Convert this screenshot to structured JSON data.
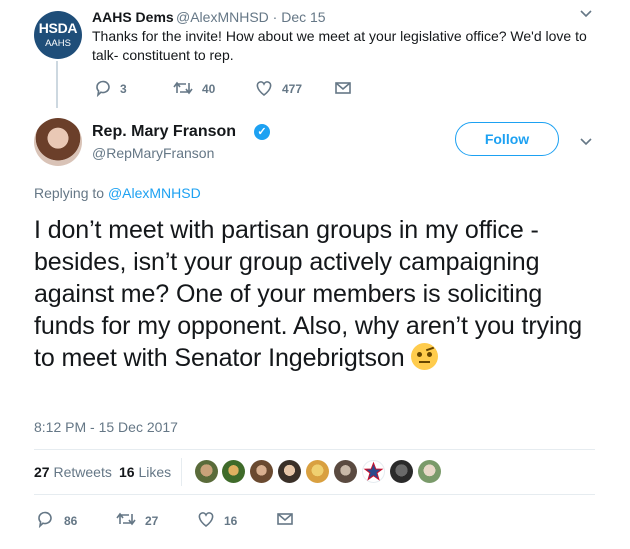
{
  "reply_tweet": {
    "avatar_text": "HSDA",
    "avatar_subtext": "AAHS",
    "display_name": "AAHS Dems",
    "handle_date": "@AlexMNHSD · Dec 15",
    "text": "Thanks for the invite! How about we meet at your legislative office? We'd love to talk- constituent to rep.",
    "reply_count": "3",
    "retweet_count": "40",
    "like_count": "477"
  },
  "main_tweet": {
    "display_name": "Rep. Mary Franson",
    "verified_glyph": "✓",
    "handle": "@RepMaryFranson",
    "follow_label": "Follow",
    "replying_prefix": "Replying to ",
    "replying_to": "@AlexMNHSD",
    "text": "I don’t meet with partisan groups in my office - besides, isn’t your group actively campaigning against me? One of your members is soliciting funds for my opponent. Also, why aren’t you trying to meet with Senator Ingebrigtson",
    "timestamp": "8:12 PM - 15 Dec 2017",
    "retweets_count": "27",
    "retweets_label": "Retweets",
    "likes_count": "16",
    "likes_label": "Likes",
    "reply_count": "86",
    "retweet_count": "27",
    "like_count": "16"
  },
  "colors": {
    "accent": "#1da1f2",
    "muted": "#657786",
    "org_avatar": "#1f4e79"
  },
  "icons": [
    "reply-icon",
    "retweet-icon",
    "like-icon",
    "message-icon",
    "chevron-down-icon",
    "verified-icon"
  ]
}
